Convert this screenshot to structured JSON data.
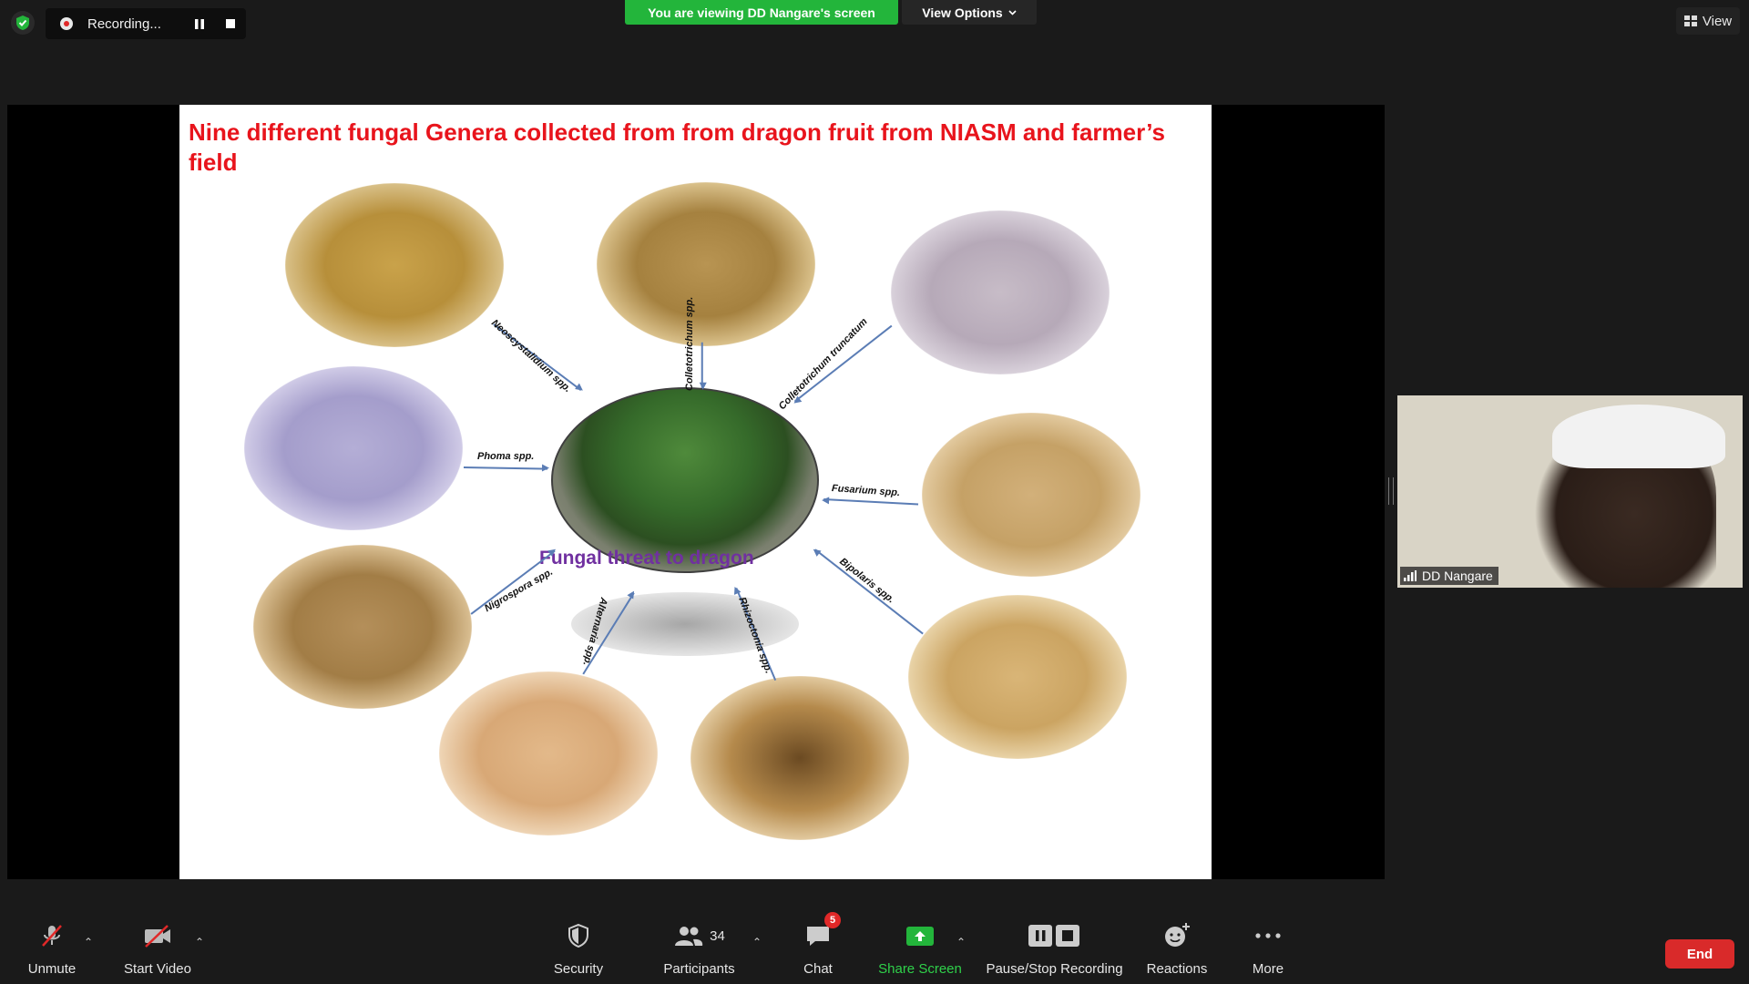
{
  "topbar": {
    "recording_label": "Recording...",
    "viewing_banner": "You are viewing DD Nangare's screen",
    "view_options_label": "View Options",
    "view_label": "View"
  },
  "slide": {
    "title": "Nine different fungal Genera collected from  from dragon fruit from NIASM and farmer’s field",
    "center_label": "Fungal threat to dragon",
    "genera": [
      "Neoscystalidium spp.",
      "Colletotrichum spp.",
      "Colletotrichum truncatum",
      "Phoma spp.",
      "Fusarium spp.",
      "Nigrospora spp.",
      "Alternaria spp.",
      "Rhizoctonia spp.",
      "Bipolaris spp."
    ]
  },
  "participant": {
    "name": "DD Nangare"
  },
  "toolbar": {
    "unmute": "Unmute",
    "start_video": "Start Video",
    "security": "Security",
    "participants": "Participants",
    "participants_count": "34",
    "chat": "Chat",
    "chat_badge": "5",
    "share_screen": "Share Screen",
    "pause_stop_recording": "Pause/Stop Recording",
    "reactions": "Reactions",
    "more": "More",
    "end": "End"
  },
  "colors": {
    "banner_green": "#23b53b",
    "share_green": "#23b53b",
    "end_red": "#d92a2a",
    "title_red": "#e8141c",
    "center_purple": "#7030a0",
    "arrow_blue": "#5b7db5"
  }
}
